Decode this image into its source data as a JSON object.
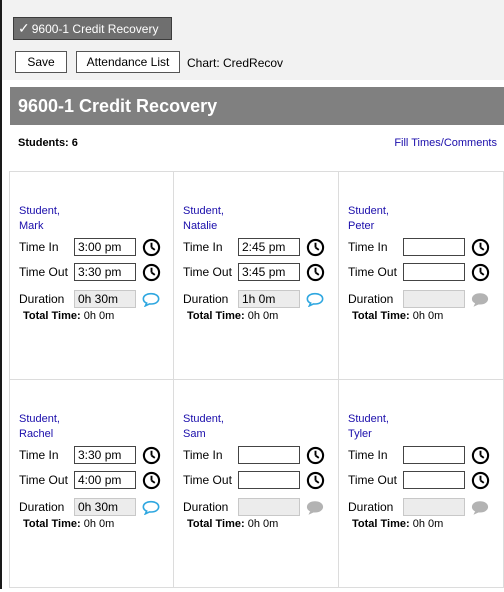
{
  "header": {
    "course_chip": "9600-1 Credit Recovery",
    "save_label": "Save",
    "attendance_label": "Attendance List",
    "chart_label": "Chart: CredRecov"
  },
  "title": "9600-1 Credit Recovery",
  "students_count": "Students: 6",
  "fill_link": "Fill Times/Comments",
  "labels": {
    "time_in": "Time In",
    "time_out": "Time Out",
    "duration": "Duration",
    "total_label": "Total Time:"
  },
  "colors": {
    "link": "#1a0dab",
    "comment_active": "#2fa7e0",
    "comment_inactive": "#b3b3b3"
  },
  "students": [
    {
      "last": "Student,",
      "first": "Mark",
      "time_in": "3:00 pm",
      "time_out": "3:30 pm",
      "duration": "0h 30m",
      "total": "0h 0m",
      "comment_active": true
    },
    {
      "last": "Student,",
      "first": "Natalie",
      "time_in": "2:45 pm",
      "time_out": "3:45 pm",
      "duration": "1h 0m",
      "total": "0h 0m",
      "comment_active": true
    },
    {
      "last": "Student,",
      "first": "Peter",
      "time_in": "",
      "time_out": "",
      "duration": "",
      "total": "0h 0m",
      "comment_active": false
    },
    {
      "last": "Student,",
      "first": "Rachel",
      "time_in": "3:30 pm",
      "time_out": "4:00 pm",
      "duration": "0h 30m",
      "total": "0h 0m",
      "comment_active": true
    },
    {
      "last": "Student,",
      "first": "Sam",
      "time_in": "",
      "time_out": "",
      "duration": "",
      "total": "0h 0m",
      "comment_active": false
    },
    {
      "last": "Student,",
      "first": "Tyler",
      "time_in": "",
      "time_out": "",
      "duration": "",
      "total": "0h 0m",
      "comment_active": false
    }
  ]
}
